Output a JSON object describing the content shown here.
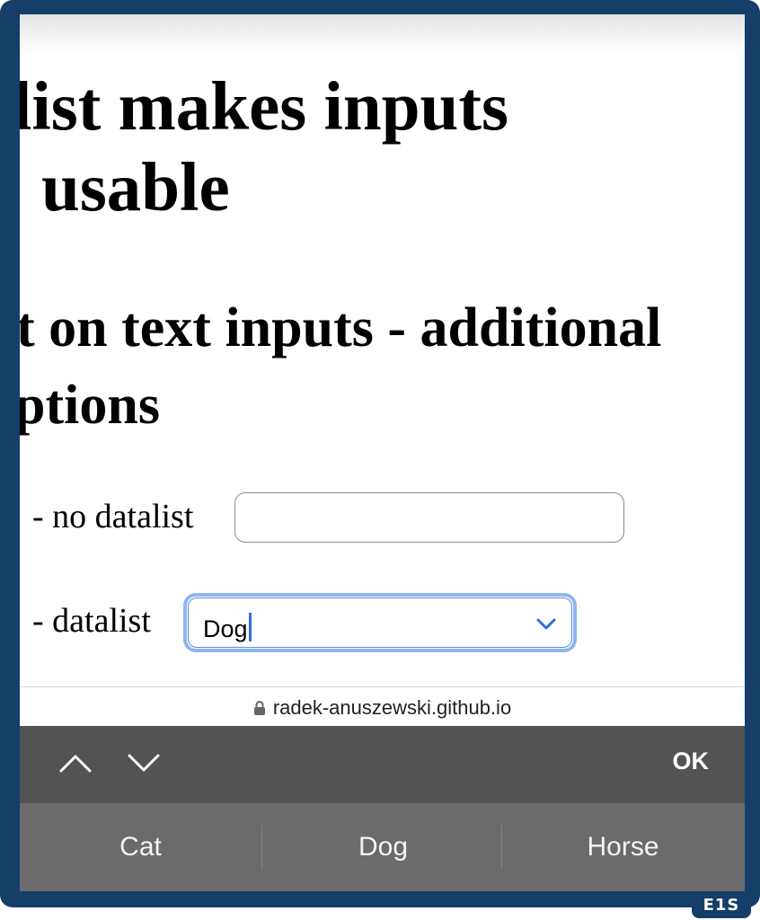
{
  "page": {
    "heading1_line1": "list makes inputs",
    "heading1_line2": "usable",
    "heading2_line1": "t on text inputs - additional",
    "heading2_line2": "ptions",
    "row1_label": "- no datalist",
    "row1_input_value": "",
    "row2_label": "- datalist",
    "row2_input_value": "Dog"
  },
  "url_bar": {
    "url": "radek-anuszewski.github.io",
    "icon": "lock-icon"
  },
  "keyboard_toolbar": {
    "prev_icon": "chevron-up-icon",
    "next_icon": "chevron-down-icon",
    "done_label": "OK"
  },
  "suggestions": [
    "Cat",
    "Dog",
    "Horse"
  ],
  "watermark": "E1S",
  "colors": {
    "frame": "#153e68",
    "focus_ring": "#8fb6ef",
    "caret": "#2e6fe0",
    "toolbar": "#535353",
    "options_bar": "#6b6b6b"
  }
}
